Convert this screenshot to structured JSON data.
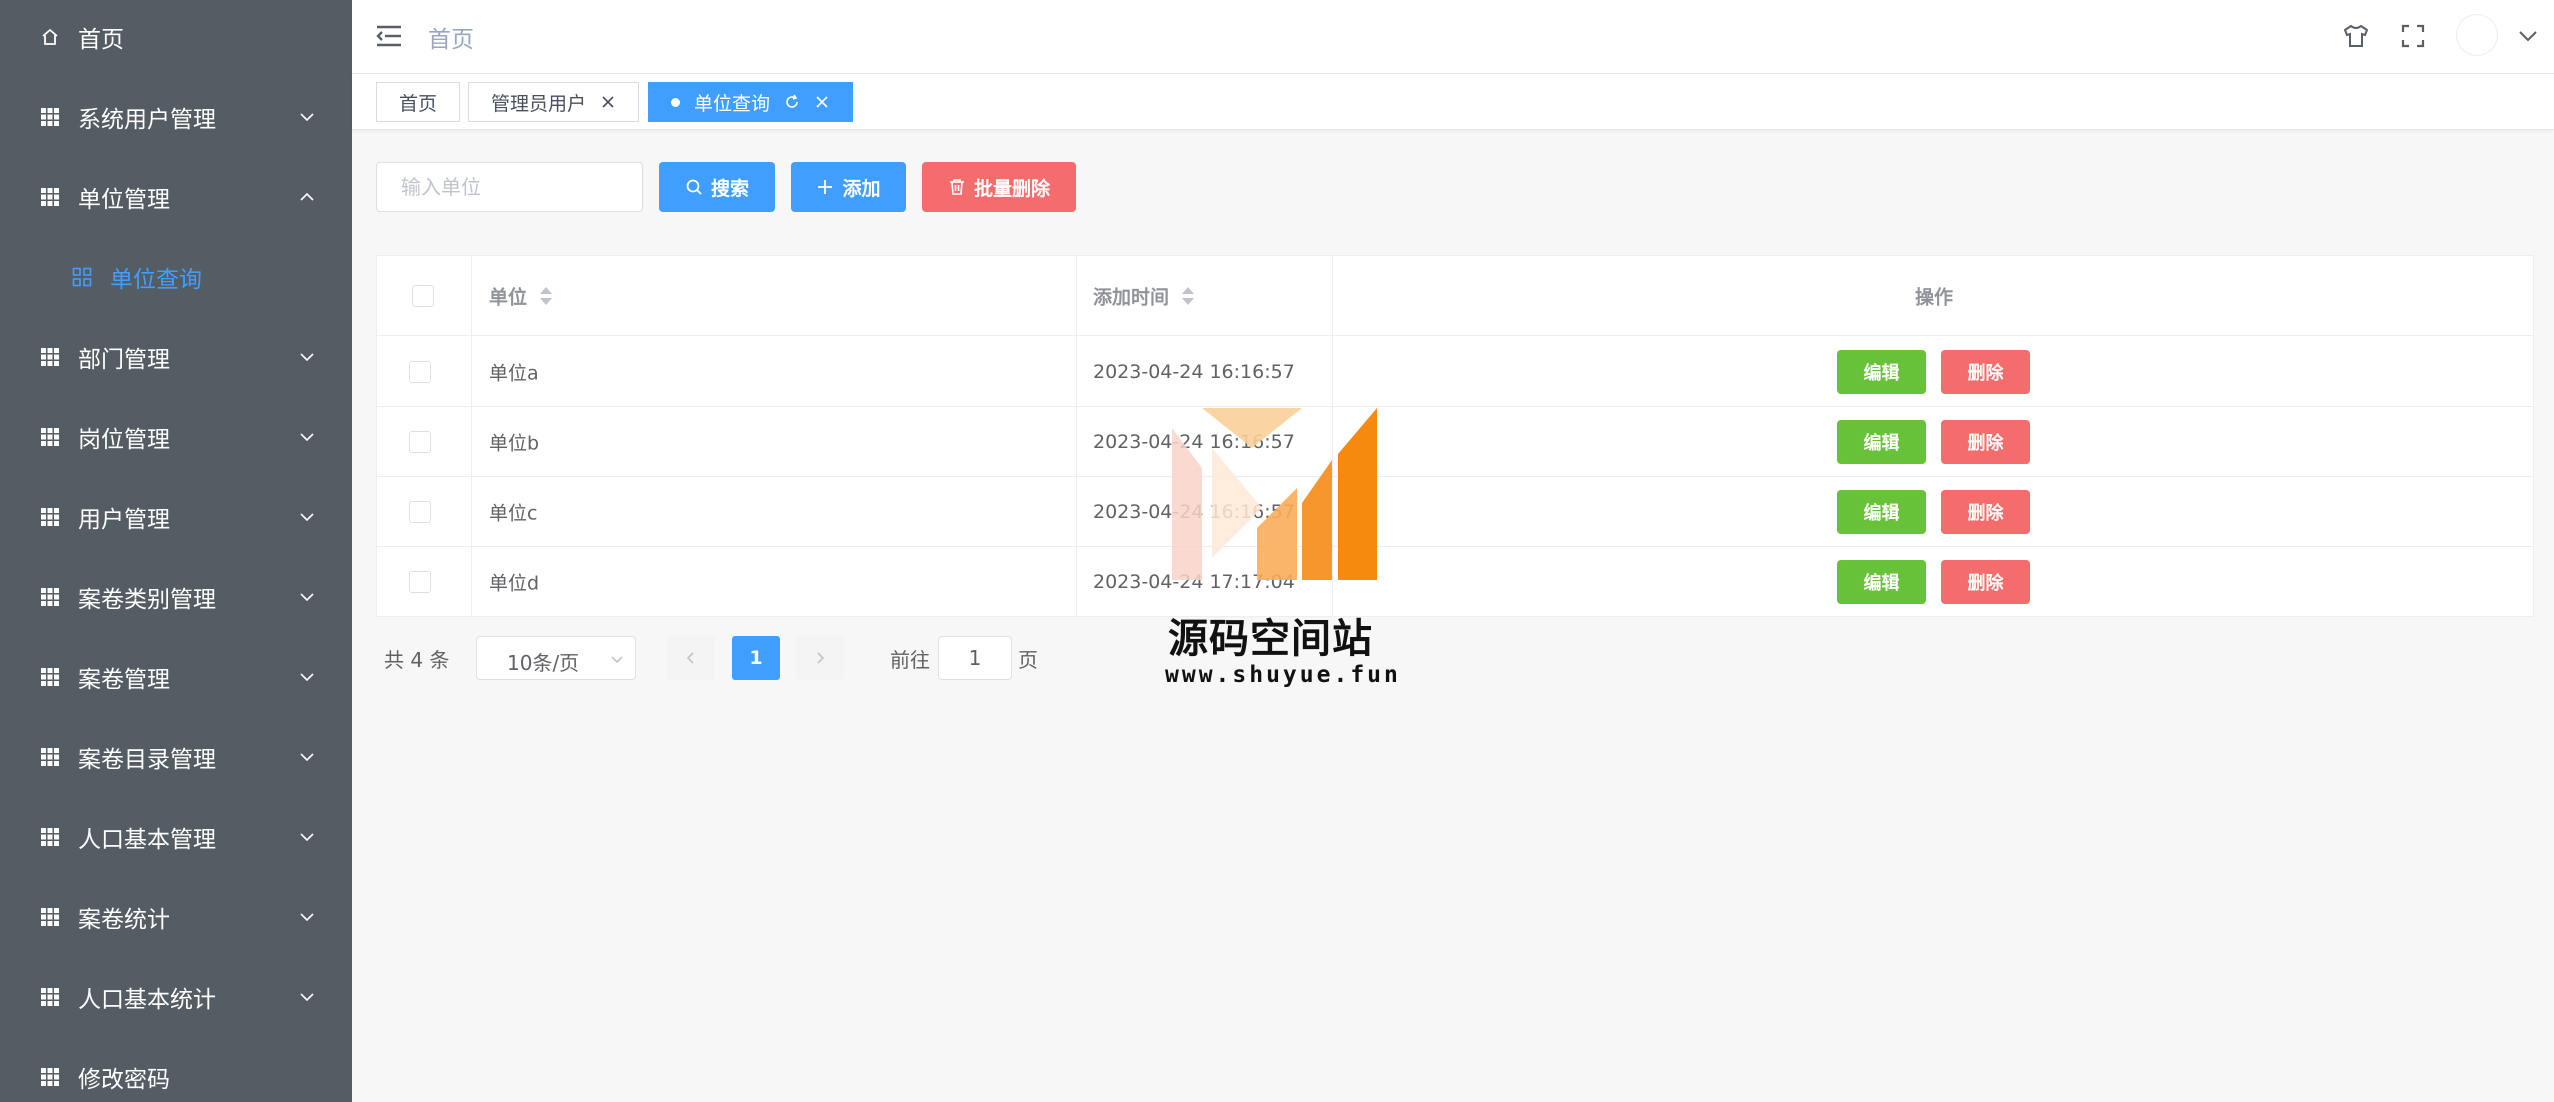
{
  "colors": {
    "sidebar_bg": "#545c64",
    "primary": "#409eff",
    "danger": "#f56c6c",
    "success": "#67c23a",
    "watermark_orange": "#f58a0f"
  },
  "sidebar": {
    "items": [
      {
        "label": "首页",
        "icon": "home-icon"
      },
      {
        "label": "系统用户管理",
        "icon": "grid-icon",
        "arrow": "chevron-down-icon"
      },
      {
        "label": "单位管理",
        "icon": "grid-icon",
        "arrow": "chevron-up-icon"
      },
      {
        "label": "单位查询",
        "icon": "squares-icon"
      },
      {
        "label": "部门管理",
        "icon": "grid-icon",
        "arrow": "chevron-down-icon"
      },
      {
        "label": "岗位管理",
        "icon": "grid-icon",
        "arrow": "chevron-down-icon"
      },
      {
        "label": "用户管理",
        "icon": "grid-icon",
        "arrow": "chevron-down-icon"
      },
      {
        "label": "案卷类别管理",
        "icon": "grid-icon",
        "arrow": "chevron-down-icon"
      },
      {
        "label": "案卷管理",
        "icon": "grid-icon",
        "arrow": "chevron-down-icon"
      },
      {
        "label": "案卷目录管理",
        "icon": "grid-icon",
        "arrow": "chevron-down-icon"
      },
      {
        "label": "人口基本管理",
        "icon": "grid-icon",
        "arrow": "chevron-down-icon"
      },
      {
        "label": "案卷统计",
        "icon": "grid-icon",
        "arrow": "chevron-down-icon"
      },
      {
        "label": "人口基本统计",
        "icon": "grid-icon",
        "arrow": "chevron-down-icon"
      },
      {
        "label": "修改密码",
        "icon": "grid-icon"
      }
    ]
  },
  "header": {
    "breadcrumb": "首页",
    "icons": [
      "hamburger-icon",
      "tshirt-icon",
      "fullscreen-icon",
      "avatar",
      "chevron-down-icon"
    ]
  },
  "tags": [
    {
      "label": "首页"
    },
    {
      "label": "管理员用户"
    },
    {
      "label": "单位查询"
    }
  ],
  "toolbar": {
    "search_placeholder": "输入单位",
    "search_button": "搜索",
    "add_button": "添加",
    "batch_delete_button": "批量删除"
  },
  "table": {
    "columns": [
      "单位",
      "添加时间",
      "操作"
    ],
    "rows": [
      {
        "unit": "单位a",
        "time": "2023-04-24 16:16:57"
      },
      {
        "unit": "单位b",
        "time": "2023-04-24 16:16:57"
      },
      {
        "unit": "单位c",
        "time": "2023-04-24 16:16:57"
      },
      {
        "unit": "单位d",
        "time": "2023-04-24 17:17:04"
      }
    ],
    "edit_label": "编辑",
    "delete_label": "删除"
  },
  "pagination": {
    "total": "共 4 条",
    "page_size": "10条/页",
    "current_page": "1",
    "goto_label": "前往",
    "goto_value": "1",
    "page_suffix": "页"
  },
  "watermark": {
    "title": "源码空间站",
    "url": "www.shuyue.fun"
  }
}
